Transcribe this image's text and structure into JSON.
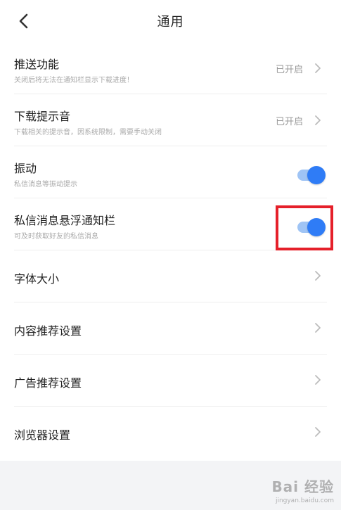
{
  "header": {
    "title": "通用"
  },
  "settings": [
    {
      "label": "推送功能",
      "sub": "关闭后将无法在通知栏显示下载进度！",
      "value": "已开启"
    },
    {
      "label": "下载提示音",
      "sub": "下载相关的提示音，因系统限制，需要手动关闭",
      "value": "已开启"
    },
    {
      "label": "振动",
      "sub": "私信消息等振动提示",
      "toggle_on": true
    },
    {
      "label": "私信消息悬浮通知栏",
      "sub": "可及时获取好友的私信消息",
      "toggle_on": true
    },
    {
      "label": "字体大小"
    },
    {
      "label": "内容推荐设置"
    },
    {
      "label": "广告推荐设置"
    },
    {
      "label": "浏览器设置"
    }
  ],
  "watermark": {
    "title": "Bai 经验",
    "url": "jingyan.baidu.com"
  },
  "colors": {
    "accent": "#2f7cf6",
    "highlight": "#e5202a"
  }
}
